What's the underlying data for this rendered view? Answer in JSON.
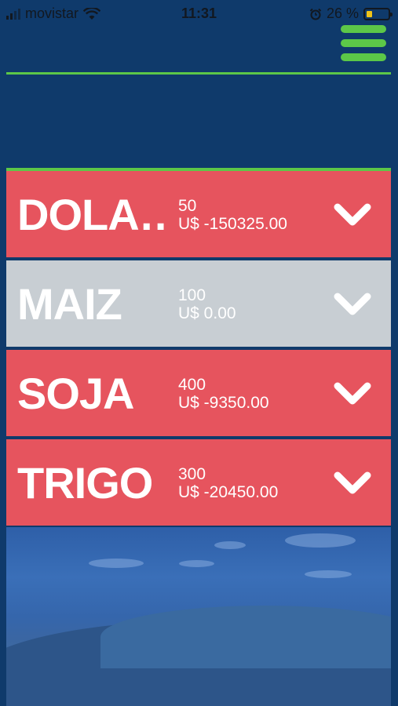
{
  "status": {
    "carrier": "movistar",
    "time": "11:31",
    "battery_percent": "26 %",
    "battery_level": 0.26,
    "icons": [
      "signal-icon",
      "wifi-icon",
      "alarm-icon",
      "battery-icon"
    ]
  },
  "header": {
    "menu_icon": "hamburger-icon",
    "accent": "#5cc748"
  },
  "items": [
    {
      "name": "DOLA…",
      "qty": "50",
      "value": "U$ -150325.00",
      "color": "#e6545e",
      "icon": "chevron-down-icon"
    },
    {
      "name": "MAIZ",
      "qty": "100",
      "value": "U$ 0.00",
      "color": "#c8ced3",
      "icon": "chevron-down-icon"
    },
    {
      "name": "SOJA",
      "qty": "400",
      "value": "U$ -9350.00",
      "color": "#e6545e",
      "icon": "chevron-down-icon"
    },
    {
      "name": "TRIGO",
      "qty": "300",
      "value": "U$ -20450.00",
      "color": "#e6545e",
      "icon": "chevron-down-icon"
    }
  ],
  "background": {
    "color": "#0f3a6b"
  }
}
